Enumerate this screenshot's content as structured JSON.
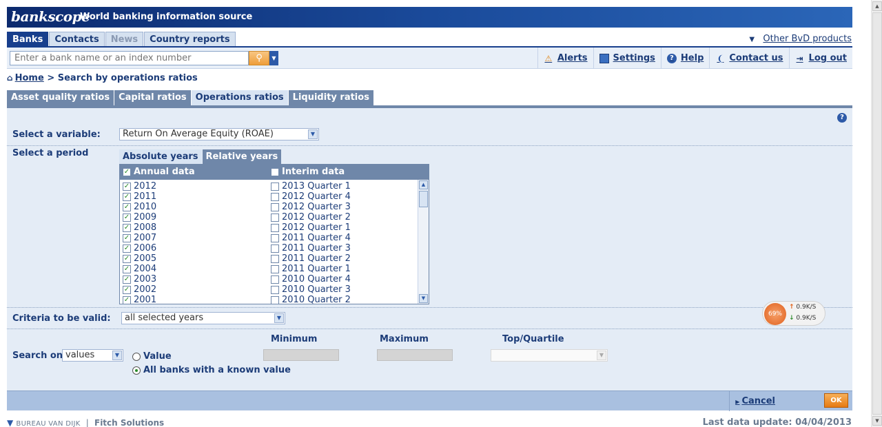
{
  "header": {
    "logo": "bankscope",
    "tagline": "World banking information source"
  },
  "nav_tabs": [
    {
      "label": "Banks",
      "state": "active"
    },
    {
      "label": "Contacts",
      "state": "normal"
    },
    {
      "label": "News",
      "state": "disabled"
    },
    {
      "label": "Country reports",
      "state": "normal"
    }
  ],
  "other_products": "Other BvD products",
  "search": {
    "placeholder": "Enter a bank name or an index number"
  },
  "toolbar_links": [
    {
      "label": "Alerts",
      "icon": "alert-icon"
    },
    {
      "label": "Settings",
      "icon": "settings-icon"
    },
    {
      "label": "Help",
      "icon": "help-icon"
    },
    {
      "label": "Contact us",
      "icon": "contact-icon"
    },
    {
      "label": "Log out",
      "icon": "logout-icon"
    }
  ],
  "breadcrumb": {
    "home": "Home",
    "separator": ">",
    "current": "Search by operations ratios"
  },
  "ratio_tabs": [
    {
      "label": "Asset quality ratios",
      "active": false
    },
    {
      "label": "Capital ratios",
      "active": false
    },
    {
      "label": "Operations ratios",
      "active": true
    },
    {
      "label": "Liquidity ratios",
      "active": false
    }
  ],
  "variable": {
    "label": "Select a variable:",
    "value": "Return On Average Equity (ROAE)"
  },
  "period": {
    "label": "Select a period",
    "tabs": [
      "Absolute years",
      "Relative years"
    ],
    "annual_header": "Annual data",
    "interim_header": "Interim data",
    "annual_items": [
      "2012",
      "2011",
      "2010",
      "2009",
      "2008",
      "2007",
      "2006",
      "2005",
      "2004",
      "2003",
      "2002",
      "2001"
    ],
    "interim_items": [
      "2013 Quarter 1",
      "2012 Quarter 4",
      "2012 Quarter 3",
      "2012 Quarter 2",
      "2012 Quarter 1",
      "2011 Quarter 4",
      "2011 Quarter 3",
      "2011 Quarter 2",
      "2011 Quarter 1",
      "2010 Quarter 4",
      "2010 Quarter 3",
      "2010 Quarter 2"
    ],
    "annual_checked": true,
    "interim_checked": false
  },
  "criteria": {
    "label": "Criteria to be valid:",
    "value": "all selected years"
  },
  "search_on": {
    "label": "Search on",
    "value": "values",
    "radio_value": "Value",
    "radio_all": "All banks with a known value",
    "minimum": "Minimum",
    "maximum": "Maximum",
    "top_quartile": "Top/Quartile"
  },
  "footer": {
    "cancel": "Cancel",
    "ok": "OK"
  },
  "bottom": {
    "bvd": "BUREAU VAN DIJK",
    "divider": "|",
    "fitch": "Fitch Solutions",
    "last_update": "Last data update: 04/04/2013"
  },
  "net_widget": {
    "percent": "69%",
    "up": "0.9K/S",
    "down": "0.9K/S"
  }
}
